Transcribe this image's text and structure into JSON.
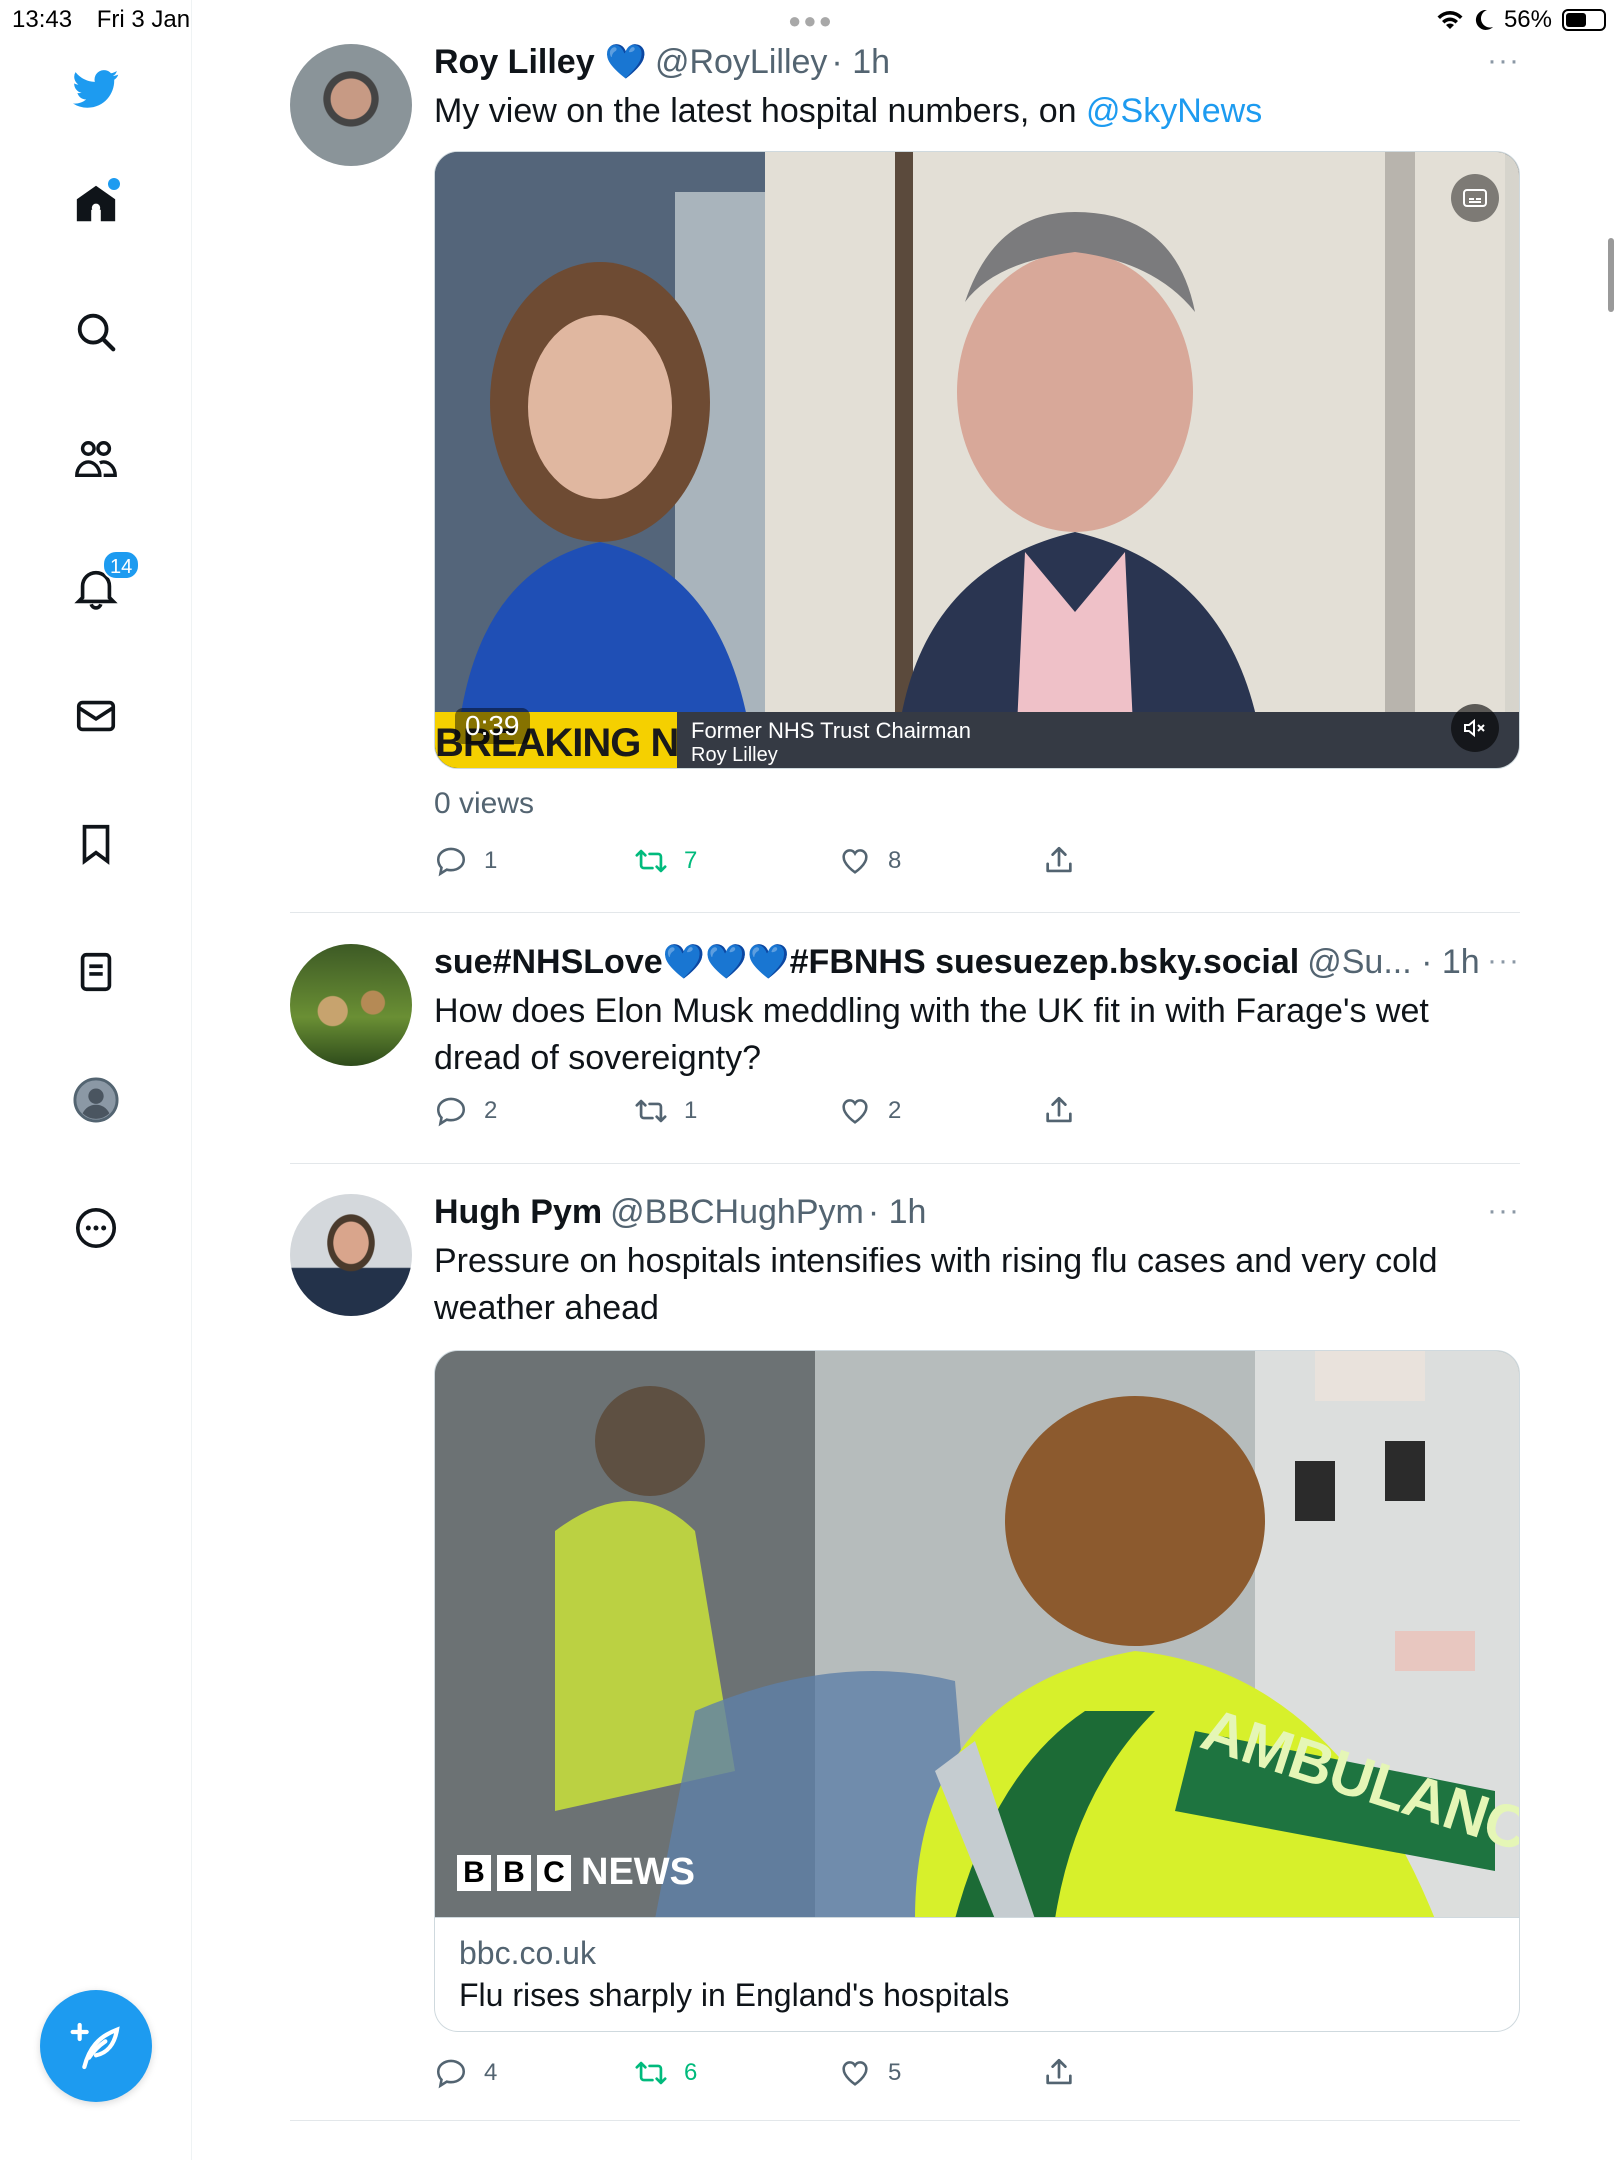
{
  "status_bar": {
    "time": "13:43",
    "date": "Fri 3 Jan",
    "battery": "56%",
    "battery_level": 0.56
  },
  "sidebar": {
    "icons": [
      "twitter-logo-icon",
      "home-icon",
      "search-icon",
      "communities-icon",
      "notifications-icon",
      "messages-icon",
      "bookmarks-icon",
      "lists-icon",
      "profile-icon",
      "more-icon"
    ],
    "notifications_badge": "14",
    "compose_icon": "compose-icon"
  },
  "colors": {
    "accent": "#1d9bf0",
    "retweet": "#00ba7c",
    "muted": "#536471"
  },
  "tweets": [
    {
      "name": "Roy Lilley",
      "verified": "💙",
      "handle": "@RoyLilley",
      "time": "· 1h",
      "text_prefix": "My view on the latest hospital numbers, on ",
      "mention": "@SkyNews",
      "video": {
        "duration": "0:39",
        "ticker": "BREAKING NEWS",
        "caption_title": "Former NHS Trust Chairman",
        "caption_name": "Roy Lilley"
      },
      "views": "0 views",
      "replies": "1",
      "retweets": "7",
      "likes": "8"
    },
    {
      "name": "sue#NHSLove💙💙💙#FBNHS suesuezep.bsky.social",
      "handle": "@Su... · 1h",
      "text": "How does Elon Musk meddling with the UK fit in with Farage's wet dread of sovereignty?",
      "replies": "2",
      "retweets": "1",
      "likes": "2"
    },
    {
      "name": "Hugh Pym",
      "handle": "@BBCHughPym",
      "time": "· 1h",
      "text": "Pressure on hospitals intensifies with rising flu cases and very cold weather ahead",
      "image": {
        "watermark_boxes": [
          "B",
          "B",
          "C"
        ],
        "watermark_word": "NEWS",
        "vest_text": "AMBULANCE"
      },
      "link_domain": "bbc.co.uk",
      "link_title": "Flu rises sharply in England's hospitals",
      "replies": "4",
      "retweets": "6",
      "likes": "5"
    }
  ],
  "more_label": "···"
}
